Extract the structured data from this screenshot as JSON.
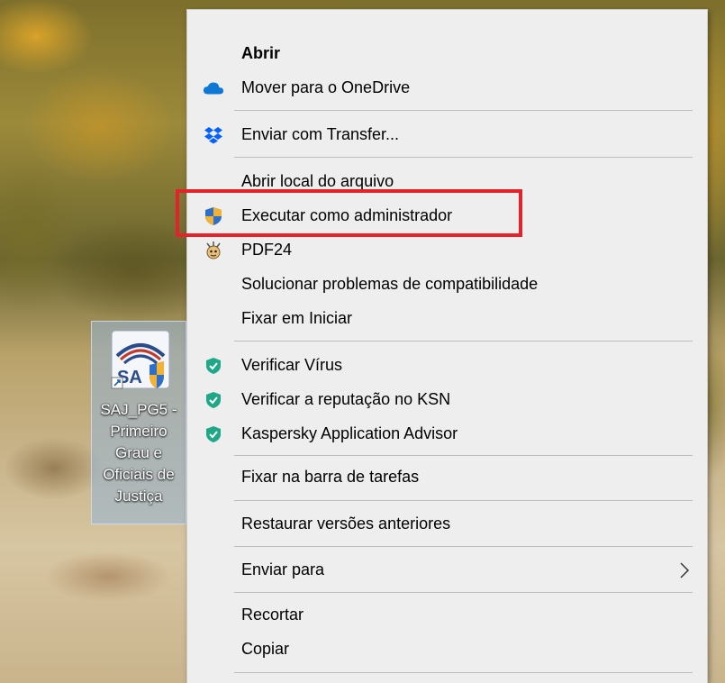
{
  "desktop": {
    "icon_label": "SAJ_PG5 -\nPrimeiro\nGrau e\nOficiais de\nJustiça"
  },
  "menu": {
    "items": [
      {
        "label": "Abrir",
        "bold": true,
        "icon": ""
      },
      {
        "label": "Mover para o OneDrive",
        "icon": "onedrive-cloud-icon"
      },
      {
        "label": "Enviar com Transfer...",
        "icon": "dropbox-icon"
      },
      {
        "label": "Abrir local do arquivo",
        "icon": ""
      },
      {
        "label": "Executar como administrador",
        "icon": "uac-shield-icon"
      },
      {
        "label": "PDF24",
        "icon": "pdf24-icon"
      },
      {
        "label": "Solucionar problemas de compatibilidade",
        "icon": ""
      },
      {
        "label": "Fixar em Iniciar",
        "icon": ""
      },
      {
        "label": "Verificar Vírus",
        "icon": "kaspersky-shield-icon"
      },
      {
        "label": "Verificar a reputação no KSN",
        "icon": "kaspersky-shield-icon"
      },
      {
        "label": "Kaspersky Application Advisor",
        "icon": "kaspersky-shield-icon"
      },
      {
        "label": "Fixar na barra de tarefas",
        "icon": ""
      },
      {
        "label": "Restaurar versões anteriores",
        "icon": ""
      },
      {
        "label": "Enviar para",
        "icon": "",
        "submenu": true
      },
      {
        "label": "Recortar",
        "icon": ""
      },
      {
        "label": "Copiar",
        "icon": ""
      }
    ]
  },
  "colors": {
    "menu_bg": "#eeeeee",
    "highlight": "#e2232a",
    "onedrive": "#0f78d4",
    "kaspersky": "#1fa887"
  }
}
